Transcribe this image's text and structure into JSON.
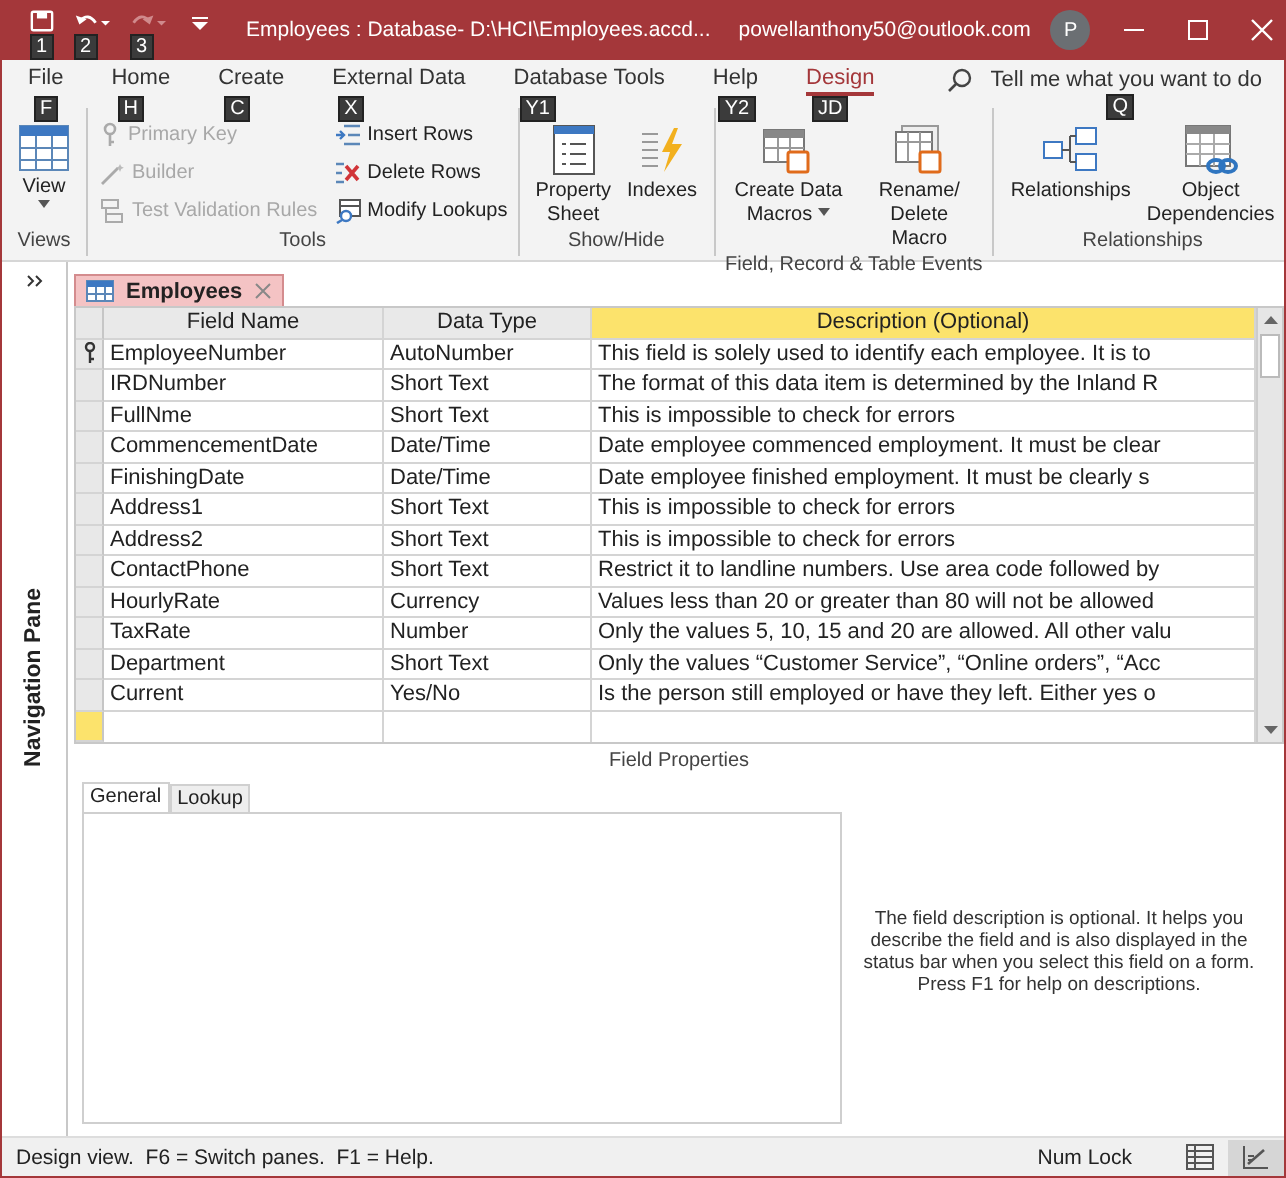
{
  "window": {
    "title": "Employees : Database- D:\\HCI\\Employees.accd...",
    "account": "powellanthony50@outlook.com",
    "avatar": "P"
  },
  "quick_access": [
    {
      "kind": "save",
      "keytip": "1",
      "disabled": false
    },
    {
      "kind": "undo",
      "keytip": "2",
      "disabled": false
    },
    {
      "kind": "redo",
      "keytip": "3",
      "disabled": true
    }
  ],
  "tabs": [
    {
      "label": "File",
      "keytip": "F",
      "selected": false
    },
    {
      "label": "Home",
      "keytip": "H",
      "selected": false
    },
    {
      "label": "Create",
      "keytip": "C",
      "selected": false
    },
    {
      "label": "External Data",
      "keytip": "X",
      "selected": false
    },
    {
      "label": "Database Tools",
      "keytip": "Y1",
      "selected": false
    },
    {
      "label": "Help",
      "keytip": "Y2",
      "selected": false
    },
    {
      "label": "Design",
      "keytip": "JD",
      "selected": true
    }
  ],
  "tell_me": {
    "placeholder": "Tell me what you want to do",
    "keytip": "Q"
  },
  "ribbon": {
    "views": {
      "label": "Views",
      "view_button": "View"
    },
    "tools": {
      "label": "Tools",
      "items": [
        {
          "kind": "primary-key",
          "label": "Primary Key",
          "disabled": true
        },
        {
          "kind": "builder",
          "label": "Builder",
          "disabled": true
        },
        {
          "kind": "test",
          "label": "Test Validation Rules",
          "disabled": true
        },
        {
          "kind": "insert",
          "label": "Insert Rows",
          "disabled": false
        },
        {
          "kind": "delete",
          "label": "Delete Rows",
          "disabled": false
        },
        {
          "kind": "lookup",
          "label": "Modify Lookups",
          "disabled": false
        }
      ]
    },
    "show_hide": {
      "label": "Show/Hide",
      "items": [
        {
          "kind": "sheet",
          "label": "Property Sheet"
        },
        {
          "kind": "indexes",
          "label": "Indexes"
        }
      ]
    },
    "events": {
      "label": "Field, Record & Table Events",
      "items": [
        {
          "kind": "create-macro",
          "label": "Create Data Macros",
          "dropdown": true
        },
        {
          "kind": "rename-macro",
          "label": "Rename/ Delete Macro",
          "dropdown": false
        }
      ]
    },
    "relationships": {
      "label": "Relationships",
      "items": [
        {
          "kind": "relationships",
          "label": "Relationships"
        },
        {
          "kind": "dependencies",
          "label": "Object Dependencies"
        }
      ]
    }
  },
  "navigation_pane": {
    "label": "Navigation Pane"
  },
  "document_tab": {
    "label": "Employees"
  },
  "table": {
    "columns": [
      {
        "label": "Field Name",
        "selected": false
      },
      {
        "label": "Data Type",
        "selected": false
      },
      {
        "label": "Description (Optional)",
        "selected": true
      }
    ],
    "rows": [
      {
        "field": "EmployeeNumber",
        "type": "AutoNumber",
        "description": "This field is solely used to identify each employee. It is to",
        "primary_key": true
      },
      {
        "field": "IRDNumber",
        "type": "Short Text",
        "description": "The format of this data item is determined by the Inland R",
        "primary_key": false
      },
      {
        "field": "FullNme",
        "type": "Short Text",
        "description": "This is impossible to check for errors",
        "primary_key": false
      },
      {
        "field": "CommencementDate",
        "type": "Date/Time",
        "description": "Date employee commenced employment. It must be clear",
        "primary_key": false
      },
      {
        "field": "FinishingDate",
        "type": "Date/Time",
        "description": "Date employee finished employment. It must be clearly s",
        "primary_key": false
      },
      {
        "field": "Address1",
        "type": "Short Text",
        "description": "This is impossible to check for errors",
        "primary_key": false
      },
      {
        "field": "Address2",
        "type": "Short Text",
        "description": "This is impossible to check for errors",
        "primary_key": false
      },
      {
        "field": "ContactPhone",
        "type": "Short Text",
        "description": "Restrict it to landline numbers. Use area code followed by",
        "primary_key": false
      },
      {
        "field": "HourlyRate",
        "type": "Currency",
        "description": "Values less than 20 or greater than 80 will not be allowed",
        "primary_key": false
      },
      {
        "field": "TaxRate",
        "type": "Number",
        "description": "Only the values 5, 10, 15 and 20 are allowed.  All other valu",
        "primary_key": false
      },
      {
        "field": "Department",
        "type": "Short Text",
        "description": "Only the values “Customer Service”, “Online orders”, “Acc",
        "primary_key": false
      },
      {
        "field": "Current",
        "type": "Yes/No",
        "description": "Is the person still employed or have they left.  Either yes o",
        "primary_key": false
      }
    ],
    "new_row": {
      "selected": true
    }
  },
  "field_properties": {
    "label": "Field Properties",
    "tabs": [
      {
        "label": "General",
        "selected": true
      },
      {
        "label": "Lookup",
        "selected": false
      }
    ],
    "help": "The field description is optional. It helps you describe the field and is also displayed in the status bar when you select this field on a form. Press F1 for help on descriptions."
  },
  "status_bar": {
    "text": "Design view.  F6 = Switch panes.  F1 = Help.",
    "num_lock": "Num Lock",
    "views": [
      {
        "kind": "datasheet",
        "selected": false
      },
      {
        "kind": "design",
        "selected": true
      }
    ]
  }
}
